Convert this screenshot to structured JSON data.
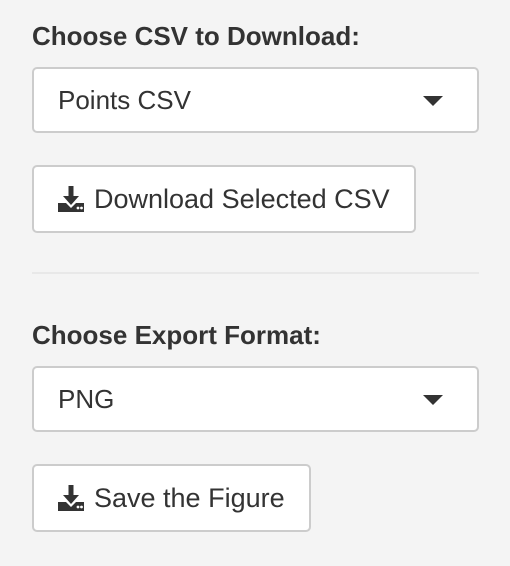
{
  "csv_section": {
    "label": "Choose CSV to Download:",
    "select": {
      "selected": "Points CSV"
    },
    "download_button": {
      "icon": "download-icon",
      "label": "Download Selected CSV"
    }
  },
  "export_section": {
    "label": "Choose Export Format:",
    "select": {
      "selected": "PNG"
    },
    "save_button": {
      "icon": "download-icon",
      "label": "Save the Figure"
    }
  },
  "colors": {
    "background": "#f4f4f4",
    "text": "#333333",
    "border": "#cccccc",
    "control_bg": "#ffffff"
  }
}
